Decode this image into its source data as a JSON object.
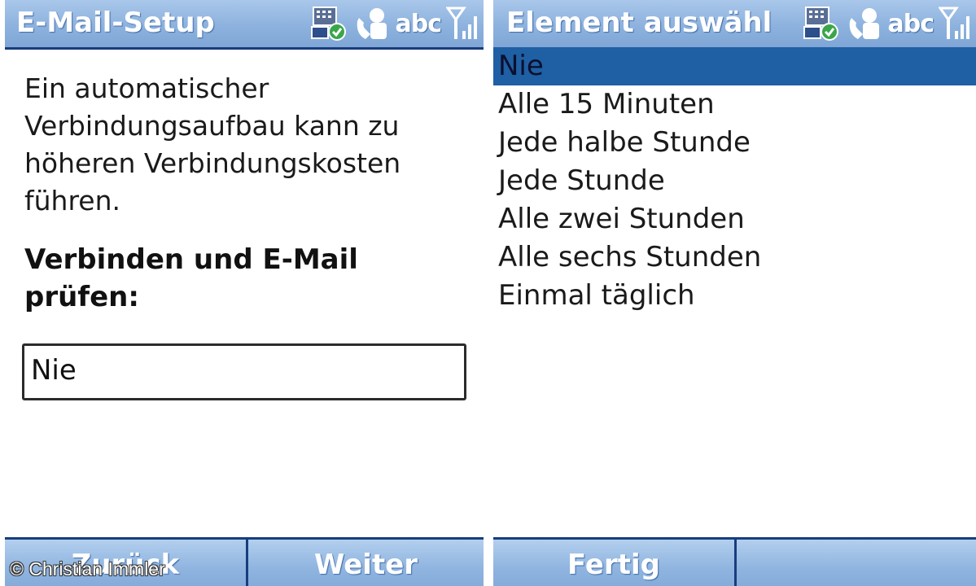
{
  "left_screen": {
    "title": "E-Mail-Setup",
    "input_mode": "abc",
    "message": "Ein automatischer Verbindungsaufbau kann zu höheren Verbindungskosten führen.",
    "field_label": "Verbinden und E-Mail prüfen:",
    "dropdown_value": "Nie",
    "softkey_left": "Zurück",
    "softkey_right": "Weiter"
  },
  "right_screen": {
    "title": "Element auswähl",
    "input_mode": "abc",
    "options": [
      "Nie",
      "Alle 15 Minuten",
      "Jede halbe Stunde",
      "Jede Stunde",
      "Alle zwei Stunden",
      "Alle sechs Stunden",
      "Einmal täglich"
    ],
    "selected_index": 0,
    "softkey_left": "Fertig",
    "softkey_right": ""
  },
  "icons": [
    "sync-status-icon",
    "phone-call-icon",
    "signal-strength-icon"
  ],
  "copyright": "© Christian Immler",
  "colors": {
    "titlebar": "#8db2de",
    "selection": "#1f5fa3",
    "border_dark": "#173c7d"
  }
}
